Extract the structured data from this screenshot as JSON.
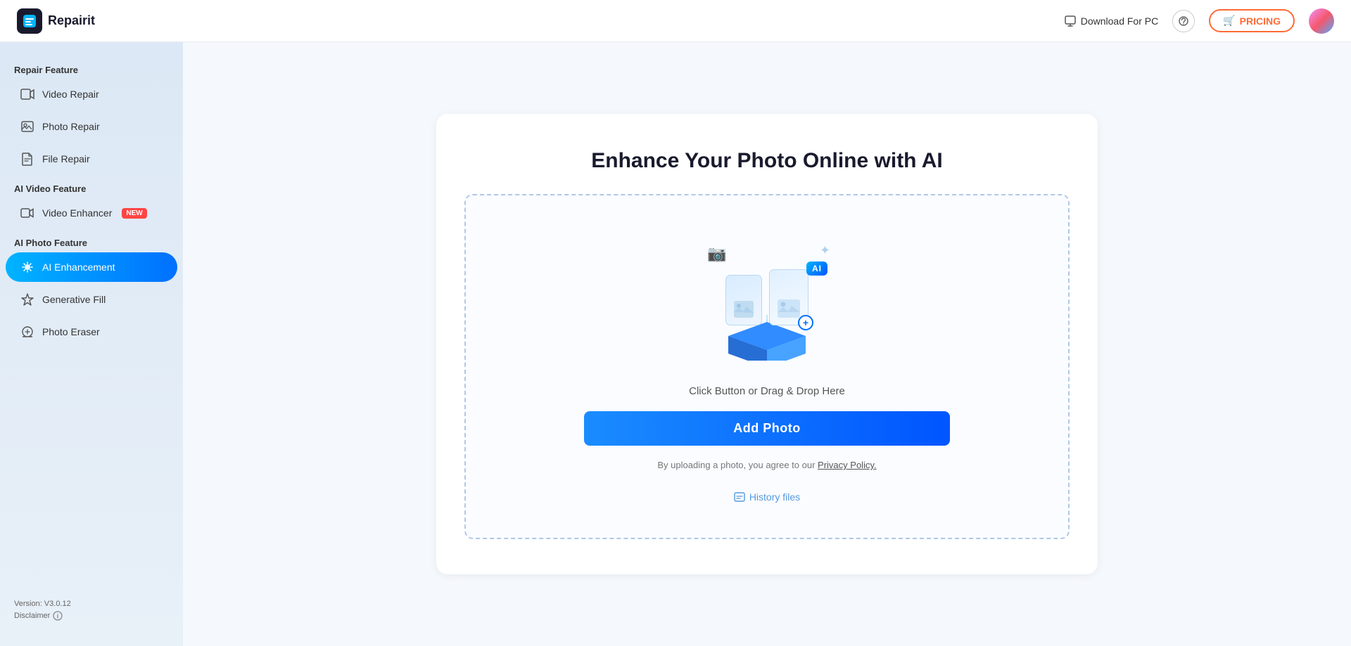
{
  "header": {
    "logo_text": "Repairit",
    "download_label": "Download For PC",
    "pricing_label": "PRICING",
    "pricing_icon": "🛒"
  },
  "sidebar": {
    "section_repair": "Repair Feature",
    "section_ai_video": "AI Video Feature",
    "section_ai_photo": "AI Photo Feature",
    "items": [
      {
        "id": "video-repair",
        "label": "Video Repair",
        "icon": "▶",
        "active": false,
        "badge": ""
      },
      {
        "id": "photo-repair",
        "label": "Photo Repair",
        "icon": "🖼",
        "active": false,
        "badge": ""
      },
      {
        "id": "file-repair",
        "label": "File Repair",
        "icon": "📄",
        "active": false,
        "badge": ""
      },
      {
        "id": "video-enhancer",
        "label": "Video Enhancer",
        "icon": "🎬",
        "active": false,
        "badge": "NEW"
      },
      {
        "id": "ai-enhancement",
        "label": "AI Enhancement",
        "icon": "✨",
        "active": true,
        "badge": ""
      },
      {
        "id": "generative-fill",
        "label": "Generative Fill",
        "icon": "⬡",
        "active": false,
        "badge": ""
      },
      {
        "id": "photo-eraser",
        "label": "Photo Eraser",
        "icon": "◇",
        "active": false,
        "badge": ""
      }
    ],
    "version": "Version: V3.0.12",
    "disclaimer_label": "Disclaimer"
  },
  "main": {
    "title": "Enhance Your Photo Online with AI",
    "drop_hint": "Click Button or Drag & Drop Here",
    "add_photo_label": "Add Photo",
    "privacy_prefix": "By uploading a photo, you agree to our ",
    "privacy_link": "Privacy Policy.",
    "history_label": "History files",
    "ai_badge": "AI"
  }
}
